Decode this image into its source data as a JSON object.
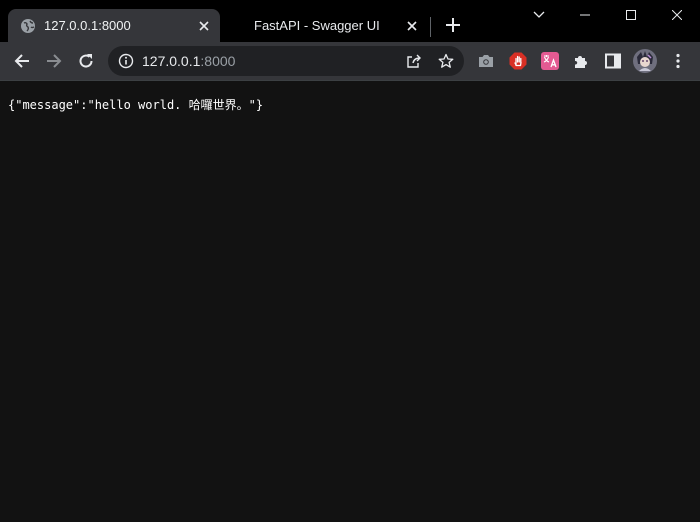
{
  "tabs": [
    {
      "title": "127.0.0.1:8000",
      "active": true
    },
    {
      "title": "FastAPI - Swagger UI",
      "active": false
    }
  ],
  "omnibox": {
    "host": "127.0.0.1",
    "port": ":8000"
  },
  "page": {
    "body_text": "{\"message\":\"hello world. 哈囉世界。\"}"
  },
  "colors": {
    "tabstrip": "#000000",
    "toolbar": "#35363a",
    "omnibox": "#202124",
    "page_bg": "#121212",
    "adblock_red": "#d93025",
    "translate_pink": "#e45a92"
  },
  "icons": [
    "globe-icon",
    "close-icon",
    "plus-icon",
    "minimize-icon",
    "maximize-icon",
    "chevron-down-icon",
    "back-icon",
    "forward-icon",
    "reload-icon",
    "info-icon",
    "share-icon",
    "star-icon",
    "camera-icon",
    "adblock-hand-icon",
    "translate-icon",
    "puzzle-icon",
    "sidebar-icon",
    "avatar",
    "kebab-menu-icon"
  ]
}
